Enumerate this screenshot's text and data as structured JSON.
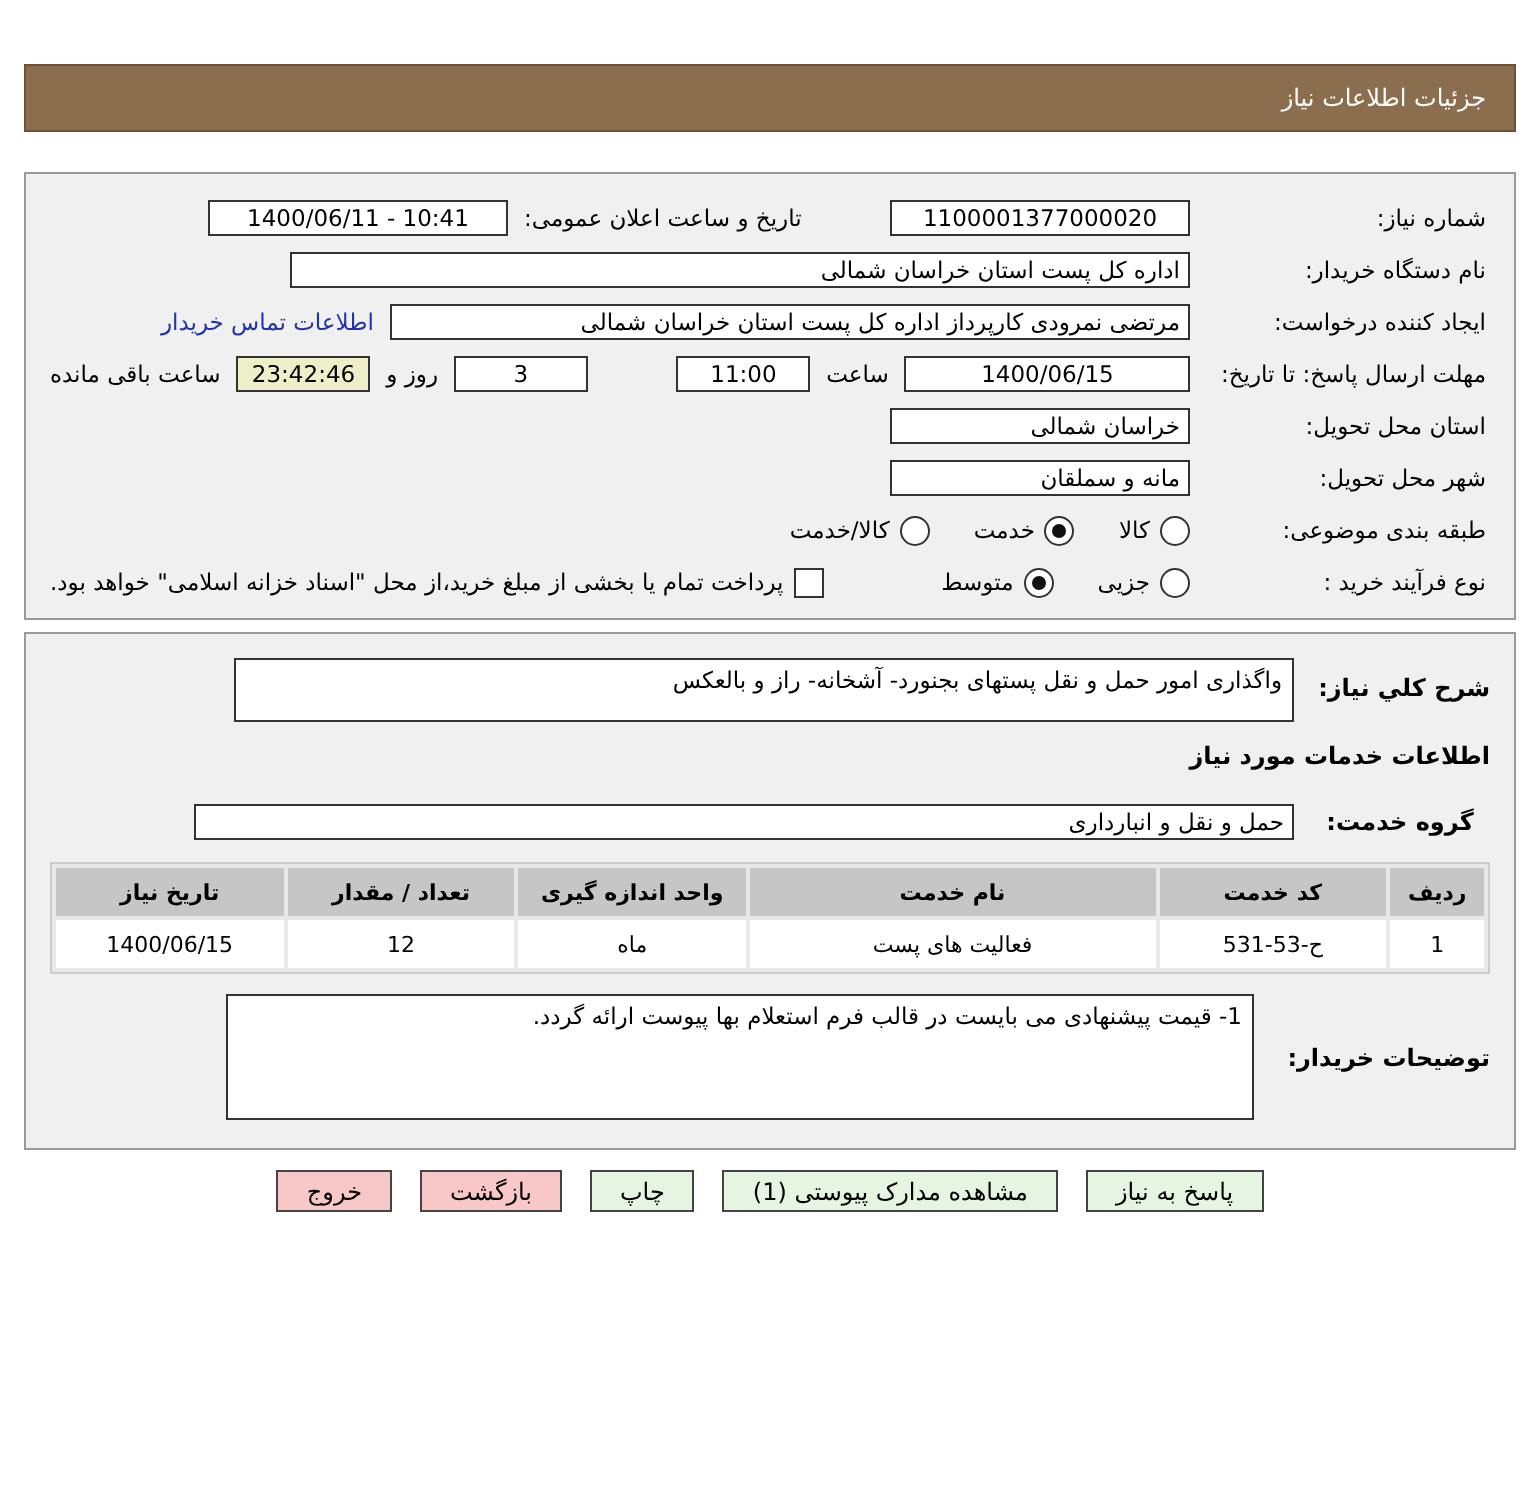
{
  "header": {
    "title": "جزئیات اطلاعات نیاز"
  },
  "need_number": {
    "label": "شماره نیاز:",
    "value": "1100001377000020"
  },
  "announce": {
    "label": "تاریخ و ساعت اعلان عمومی:",
    "value": "1400/06/11 - 10:41"
  },
  "buyer_org": {
    "label": "نام دستگاه خریدار:",
    "value": "اداره کل پست استان خراسان شمالی"
  },
  "requester": {
    "label": "ایجاد کننده درخواست:",
    "value": "مرتضی  نمرودی کارپرداز اداره کل پست استان خراسان شمالی",
    "link": "اطلاعات تماس خریدار"
  },
  "deadline": {
    "label": "مهلت ارسال پاسخ: تا تاریخ:",
    "date": "1400/06/15",
    "time_label": "ساعت",
    "time": "11:00",
    "days": "3",
    "days_label": "روز و",
    "remaining": "23:42:46",
    "remaining_label": "ساعت باقی مانده"
  },
  "province": {
    "label": "استان محل تحویل:",
    "value": "خراسان شمالی"
  },
  "city": {
    "label": "شهر محل تحویل:",
    "value": "مانه و سملقان"
  },
  "category": {
    "label": "طبقه بندی موضوعی:",
    "options": [
      {
        "label": "کالا",
        "selected": false
      },
      {
        "label": "خدمت",
        "selected": true
      },
      {
        "label": "کالا/خدمت",
        "selected": false
      }
    ]
  },
  "purchase_type": {
    "label": "نوع فرآیند خرید :",
    "options": [
      {
        "label": "جزیی",
        "selected": false
      },
      {
        "label": "متوسط",
        "selected": true
      }
    ],
    "payment": {
      "checked": false,
      "text": "پرداخت تمام یا بخشی از مبلغ خرید،از محل \"اسناد خزانه اسلامی\" خواهد بود."
    }
  },
  "description": {
    "label": "شرح کلي نياز:",
    "value": "واگذاری امور حمل و نقل پستهای بجنورد- آشخانه- راز و بالعکس"
  },
  "services_title": "اطلاعات خدمات مورد نیاز",
  "service_group": {
    "label": "گروه خدمت:",
    "value": "حمل و نقل و انبارداری"
  },
  "table": {
    "columns": [
      "ردیف",
      "کد خدمت",
      "نام خدمت",
      "واحد اندازه گیری",
      "تعداد / مقدار",
      "تاریخ نیاز"
    ],
    "rows": [
      [
        "1",
        "ح-53-531",
        "فعالیت های پست",
        "ماه",
        "12",
        "1400/06/15"
      ]
    ]
  },
  "buyer_notes": {
    "label": "توضیحات خریدار:",
    "value": "1- قیمت پیشنهادی می بایست در قالب فرم استعلام بها پیوست ارائه گردد."
  },
  "buttons": [
    {
      "label": "پاسخ به نیاز",
      "kind": "normal"
    },
    {
      "label": "مشاهده مدارک پیوستی (1)",
      "kind": "normal"
    },
    {
      "label": "چاپ",
      "kind": "normal"
    },
    {
      "label": "بازگشت",
      "kind": "danger"
    },
    {
      "label": "خروج",
      "kind": "danger"
    }
  ]
}
